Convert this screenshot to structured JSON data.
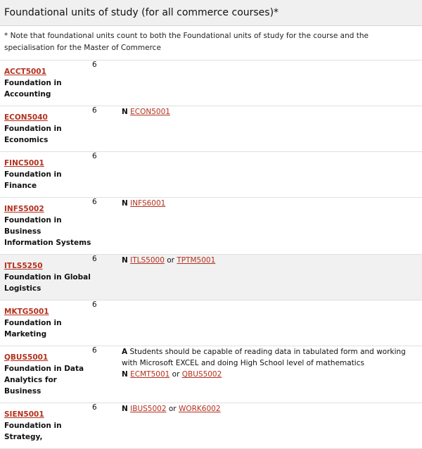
{
  "header": {
    "title": "Foundational units of study (for all commerce courses)*"
  },
  "note": "* Note that foundational units count to both the Foundational units of study for the course and the specialisation for the Master of Commerce",
  "units": [
    {
      "code": "ACCT5001",
      "title": "Foundation in Accounting",
      "cp": "6",
      "shaded": false,
      "reqs": []
    },
    {
      "code": "ECON5040",
      "title": "Foundation in Economics",
      "cp": "6",
      "shaded": false,
      "reqs": [
        {
          "key": "N",
          "text": "",
          "links": [
            "ECON5001"
          ],
          "joiner": ""
        }
      ]
    },
    {
      "code": "FINC5001",
      "title": "Foundation in Finance",
      "cp": "6",
      "shaded": false,
      "reqs": []
    },
    {
      "code": "INFS5002",
      "title": "Foundation in Business Information Systems",
      "cp": "6",
      "shaded": false,
      "reqs": [
        {
          "key": "N",
          "text": "",
          "links": [
            "INFS6001"
          ],
          "joiner": ""
        }
      ]
    },
    {
      "code": "ITLS5250",
      "title": "Foundation in Global Logistics",
      "cp": "6",
      "shaded": true,
      "reqs": [
        {
          "key": "N",
          "text": "",
          "links": [
            "ITLS5000",
            "TPTM5001"
          ],
          "joiner": "or"
        }
      ]
    },
    {
      "code": "MKTG5001",
      "title": "Foundation in Marketing",
      "cp": "6",
      "shaded": false,
      "reqs": []
    },
    {
      "code": "QBUS5001",
      "title": "Foundation in Data Analytics for Business",
      "cp": "6",
      "shaded": false,
      "reqs": [
        {
          "key": "A",
          "text": "Students should be capable of reading data in tabulated form and working with Microsoft EXCEL and doing High School level of mathematics",
          "links": [],
          "joiner": ""
        },
        {
          "key": "N",
          "text": "",
          "links": [
            "ECMT5001",
            "QBUS5002"
          ],
          "joiner": "or"
        }
      ]
    },
    {
      "code": "SIEN5001",
      "title": "Foundation in Strategy,",
      "cp": "6",
      "shaded": false,
      "reqs": [
        {
          "key": "N",
          "text": "",
          "links": [
            "IBUS5002",
            "WORK6002"
          ],
          "joiner": "or"
        }
      ]
    }
  ]
}
